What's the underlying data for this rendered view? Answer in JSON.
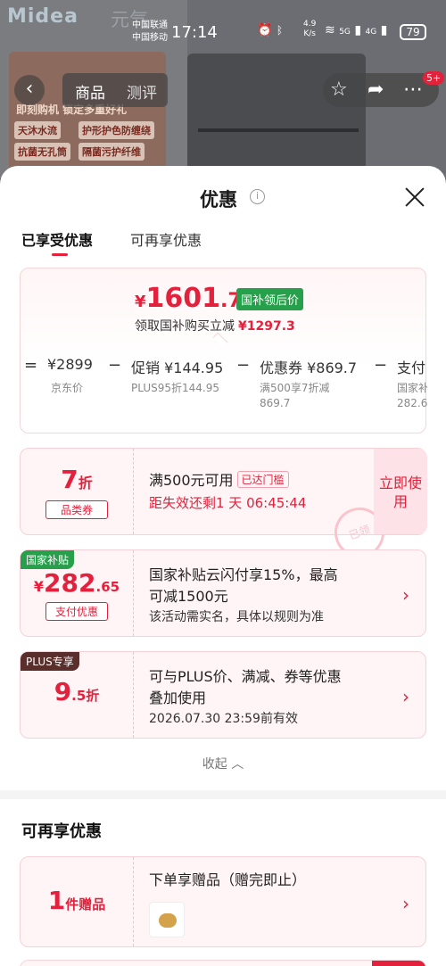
{
  "background": {
    "logo": "Midea",
    "logo2": "元气",
    "promo_lines": [
      "即刻购机 锁定多重好礼"
    ],
    "promo_tags": [
      "天沐水流",
      "护形护色防缠绕",
      "抗菌无孔筒",
      "隔菌污护纤维"
    ],
    "nav_tabs": [
      "商品",
      "测评"
    ],
    "badge": "5+"
  },
  "status_bar": {
    "carrier1": "中国联通",
    "carrier2": "中国移动",
    "time": "17:14",
    "speed_value": "4.9",
    "speed_unit": "K/s",
    "network1": "5G",
    "network2": "4G",
    "battery": "79"
  },
  "sheet": {
    "title": "优惠",
    "tabs": [
      "已享受优惠",
      "可再享优惠"
    ],
    "summary": {
      "currency": "¥",
      "price_int": "1601",
      "price_dec": ".7",
      "tag": "国补领后价",
      "sub_text": "领取国补购买立减",
      "sub_amount": "¥1297.3",
      "items": [
        {
          "op": "=",
          "value": "¥2899",
          "sub": "京东价",
          "sub2": ""
        },
        {
          "op": "−",
          "value": "促销 ¥144.95",
          "sub": "PLUS95折144.95",
          "sub2": ""
        },
        {
          "op": "−",
          "value": "优惠券 ¥869.7",
          "sub": "满500享7折减",
          "sub2": "869.7"
        },
        {
          "op": "−",
          "value": "支付",
          "sub": "国家补",
          "sub2": "282.6"
        }
      ]
    },
    "coupons": [
      {
        "big": "7",
        "big_unit": "折",
        "pill": "品类券",
        "title": "满500元可用",
        "title_tag": "已达门槛",
        "sub": "距失效还剩1 天 06:45:44",
        "action": "立即使用",
        "stamp": "已领"
      },
      {
        "corner": "国家补贴",
        "big_prefix": "¥",
        "big": "282",
        "big_dec": ".65",
        "pill": "支付优惠",
        "title_l1": "国家补贴云闪付享15%，最高",
        "title_l2": "可减1500元",
        "sub": "该活动需实名，具体以规则为准"
      },
      {
        "corner": "PLUS专享",
        "big": "9",
        "big_dec": ".5折",
        "title_l1": "可与PLUS价、满减、券等优惠",
        "title_l2": "叠加使用",
        "sub": "2026.07.30 23:59前有效"
      }
    ],
    "collapse": "收起 ︿",
    "section2_title": "可再享优惠",
    "gift": {
      "big": "1",
      "big_unit": "件赠品",
      "title": "下单享赠品（赠完即止）"
    }
  },
  "colors": {
    "accent": "#e4213c",
    "green": "#26a04a",
    "plus_tag": "#5a2e2a"
  }
}
